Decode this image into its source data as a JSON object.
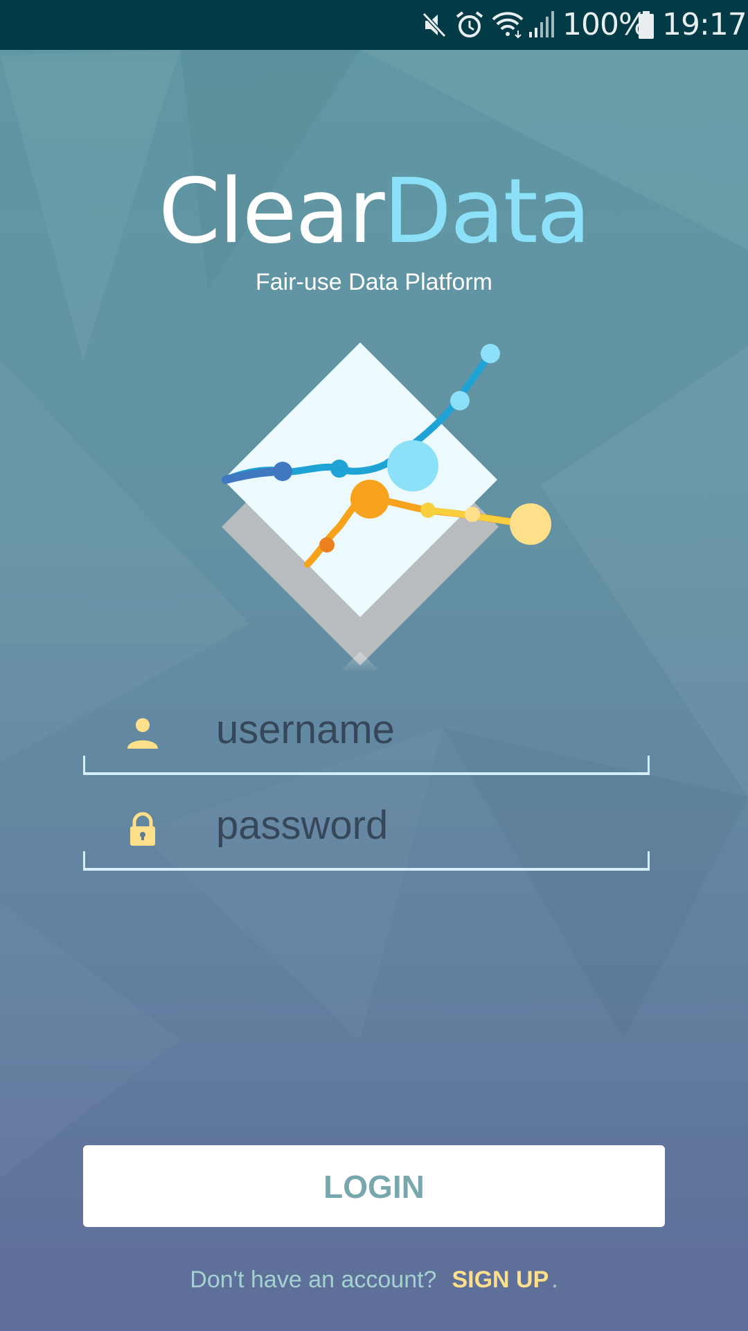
{
  "status_bar": {
    "battery": "100%",
    "time": "19:17",
    "icons": [
      "mute-icon",
      "alarm-icon",
      "wifi-icon",
      "signal-icon",
      "battery-icon"
    ]
  },
  "brand": {
    "name_part1": "Clear",
    "name_part2": "Data",
    "tagline": "Fair-use Data Platform"
  },
  "form": {
    "username": {
      "placeholder": "username",
      "icon": "person-icon"
    },
    "password": {
      "placeholder": "password",
      "icon": "lock-icon"
    }
  },
  "login": {
    "label": "LOGIN"
  },
  "signup": {
    "prompt": "Don't have an account?",
    "link": "SIGN UP",
    "trailing": "."
  },
  "colors": {
    "status_bar": "#023a45",
    "brand_accent": "#8ce0f8",
    "icon_accent": "#ffe08a",
    "button_text": "#78a8ae",
    "field_line": "#d4eefa"
  }
}
